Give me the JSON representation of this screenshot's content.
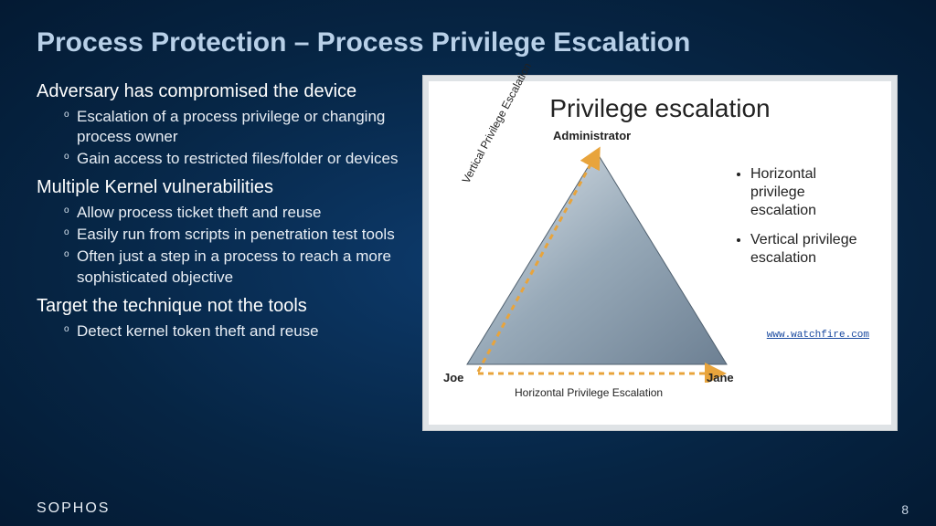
{
  "title": "Process Protection – Process Privilege Escalation",
  "sections": [
    {
      "heading": "Adversary has compromised the device",
      "items": [
        "Escalation of a process privilege or changing process owner",
        "Gain access to restricted files/folder or devices"
      ]
    },
    {
      "heading": "Multiple Kernel vulnerabilities",
      "items": [
        "Allow process ticket theft and reuse",
        "Easily run from scripts in penetration test tools",
        "Often just a step in a process to reach a more sophisticated objective"
      ]
    },
    {
      "heading": "Target the technique not the tools",
      "items": [
        "Detect kernel token theft and reuse"
      ]
    }
  ],
  "diagram": {
    "title": "Privilege escalation",
    "top": "Administrator",
    "left": "Joe",
    "right": "Jane",
    "edge_vertical": "Vertical Privilege Escalation",
    "edge_horizontal": "Horizontal Privilege Escalation",
    "bullets": [
      "Horizontal privilege escalation",
      "Vertical privilege escalation"
    ],
    "link": "www.watchfire.com"
  },
  "brand": "SOPHOS",
  "page": "8"
}
